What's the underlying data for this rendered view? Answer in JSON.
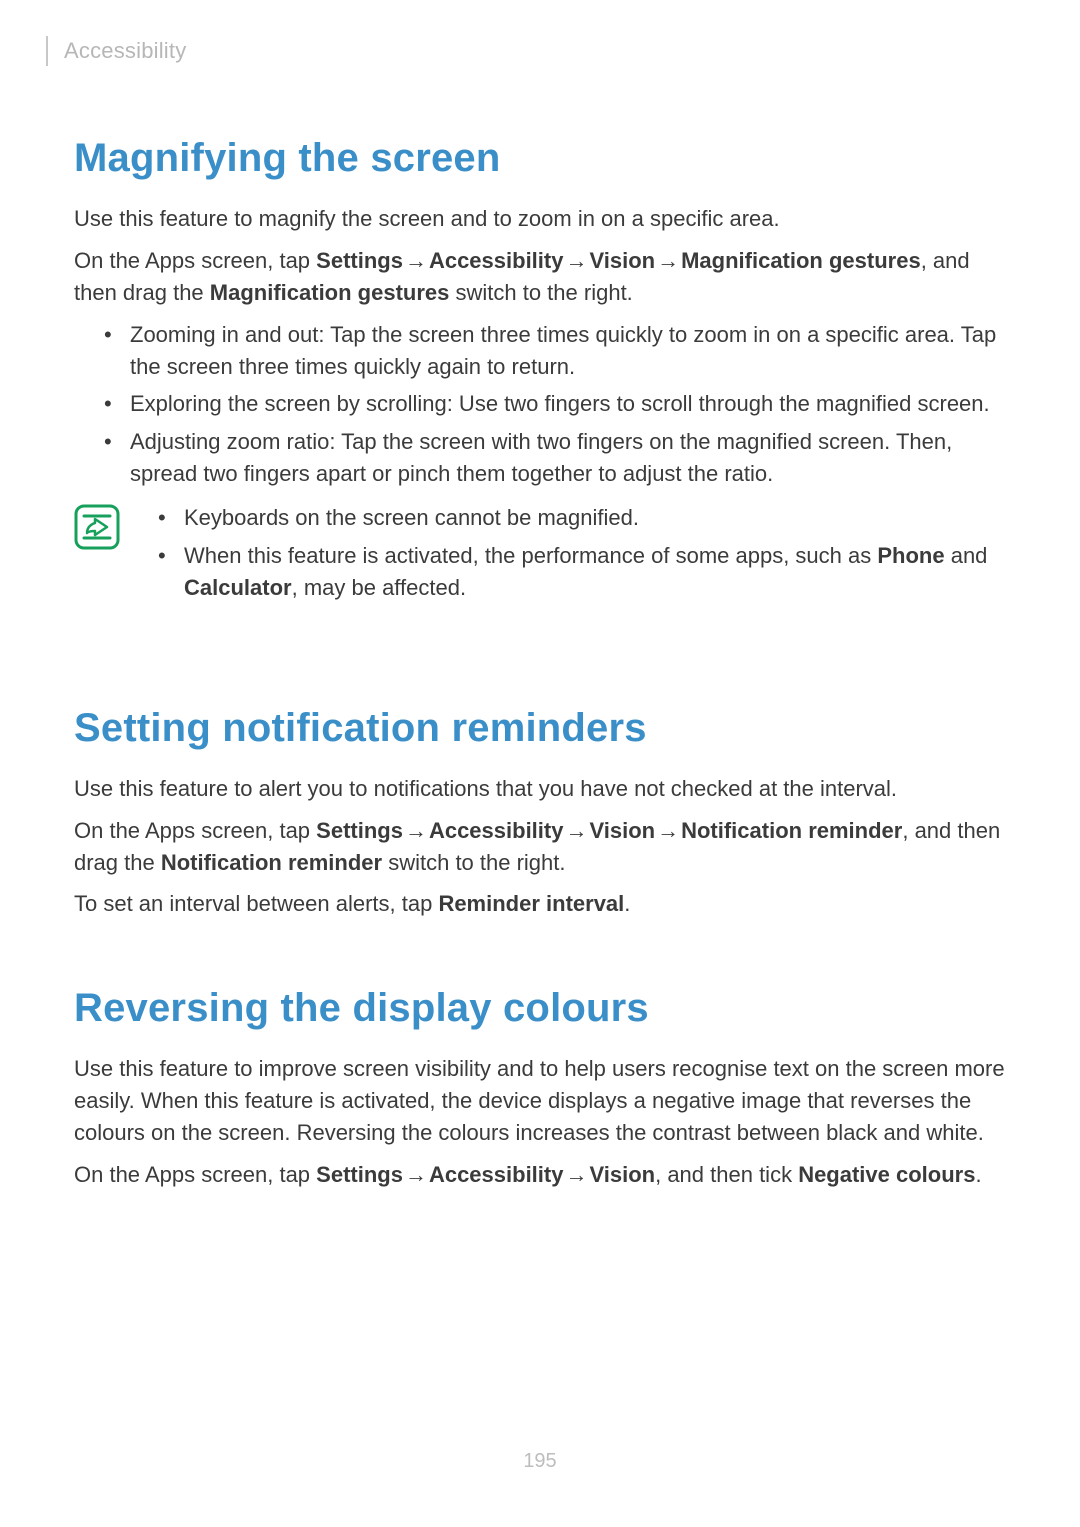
{
  "breadcrumb": "Accessibility",
  "arrow": "→",
  "sections": {
    "magnify": {
      "heading": "Magnifying the screen",
      "p1": "Use this feature to magnify the screen and to zoom in on a specific area.",
      "p2_pre": "On the Apps screen, tap ",
      "path": [
        "Settings",
        "Accessibility",
        "Vision",
        "Magnification gestures"
      ],
      "p2_mid": ", and then drag the ",
      "p2_switch": "Magnification gestures",
      "p2_post": " switch to the right.",
      "bullets": [
        "Zooming in and out: Tap the screen three times quickly to zoom in on a specific area. Tap the screen three times quickly again to return.",
        "Exploring the screen by scrolling: Use two fingers to scroll through the magnified screen.",
        "Adjusting zoom ratio: Tap the screen with two fingers on the magnified screen. Then, spread two fingers apart or pinch them together to adjust the ratio."
      ],
      "notes": {
        "n1": "Keyboards on the screen cannot be magnified.",
        "n2_pre": "When this feature is activated, the performance of some apps, such as ",
        "n2_b1": "Phone",
        "n2_mid": " and ",
        "n2_b2": "Calculator",
        "n2_post": ", may be affected."
      }
    },
    "reminders": {
      "heading": "Setting notification reminders",
      "p1": "Use this feature to alert you to notifications that you have not checked at the interval.",
      "p2_pre": "On the Apps screen, tap ",
      "path": [
        "Settings",
        "Accessibility",
        "Vision",
        "Notification reminder"
      ],
      "p2_mid": ", and then drag the ",
      "p2_switch": "Notification reminder",
      "p2_post": " switch to the right.",
      "p3_pre": "To set an interval between alerts, tap ",
      "p3_b": "Reminder interval",
      "p3_post": "."
    },
    "reverse": {
      "heading": "Reversing the display colours",
      "p1": "Use this feature to improve screen visibility and to help users recognise text on the screen more easily. When this feature is activated, the device displays a negative image that reverses the colours on the screen. Reversing the colours increases the contrast between black and white.",
      "p2_pre": "On the Apps screen, tap ",
      "path": [
        "Settings",
        "Accessibility",
        "Vision"
      ],
      "p2_mid": ", and then tick ",
      "p2_b": "Negative colours",
      "p2_post": "."
    }
  },
  "page_number": "195"
}
